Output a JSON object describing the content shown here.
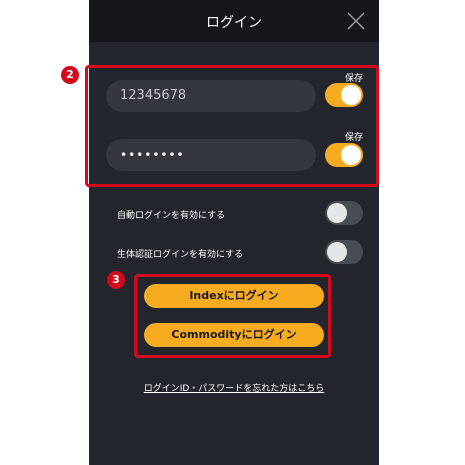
{
  "header": {
    "title": "ログイン",
    "close_icon": "close-icon"
  },
  "login": {
    "user_id": {
      "value": "12345678",
      "save_label": "保存",
      "save_enabled": true
    },
    "password": {
      "value": "••••••••",
      "save_label": "保存",
      "save_enabled": true
    }
  },
  "options": {
    "auto_login": {
      "label": "自動ログインを有効にする",
      "enabled": false
    },
    "biometric": {
      "label": "生体認証ログインを有効にする",
      "enabled": false
    }
  },
  "buttons": {
    "index_login": "Indexにログイン",
    "commodity_login": "Commodityにログイン"
  },
  "forgot_link": "ログインID・パスワードを忘れた方はこちら",
  "callouts": {
    "fields": "2",
    "buttons": "3"
  },
  "colors": {
    "accent": "#f7ab21",
    "background": "#24262e",
    "header": "#16171c",
    "callout": "#d4091c"
  }
}
